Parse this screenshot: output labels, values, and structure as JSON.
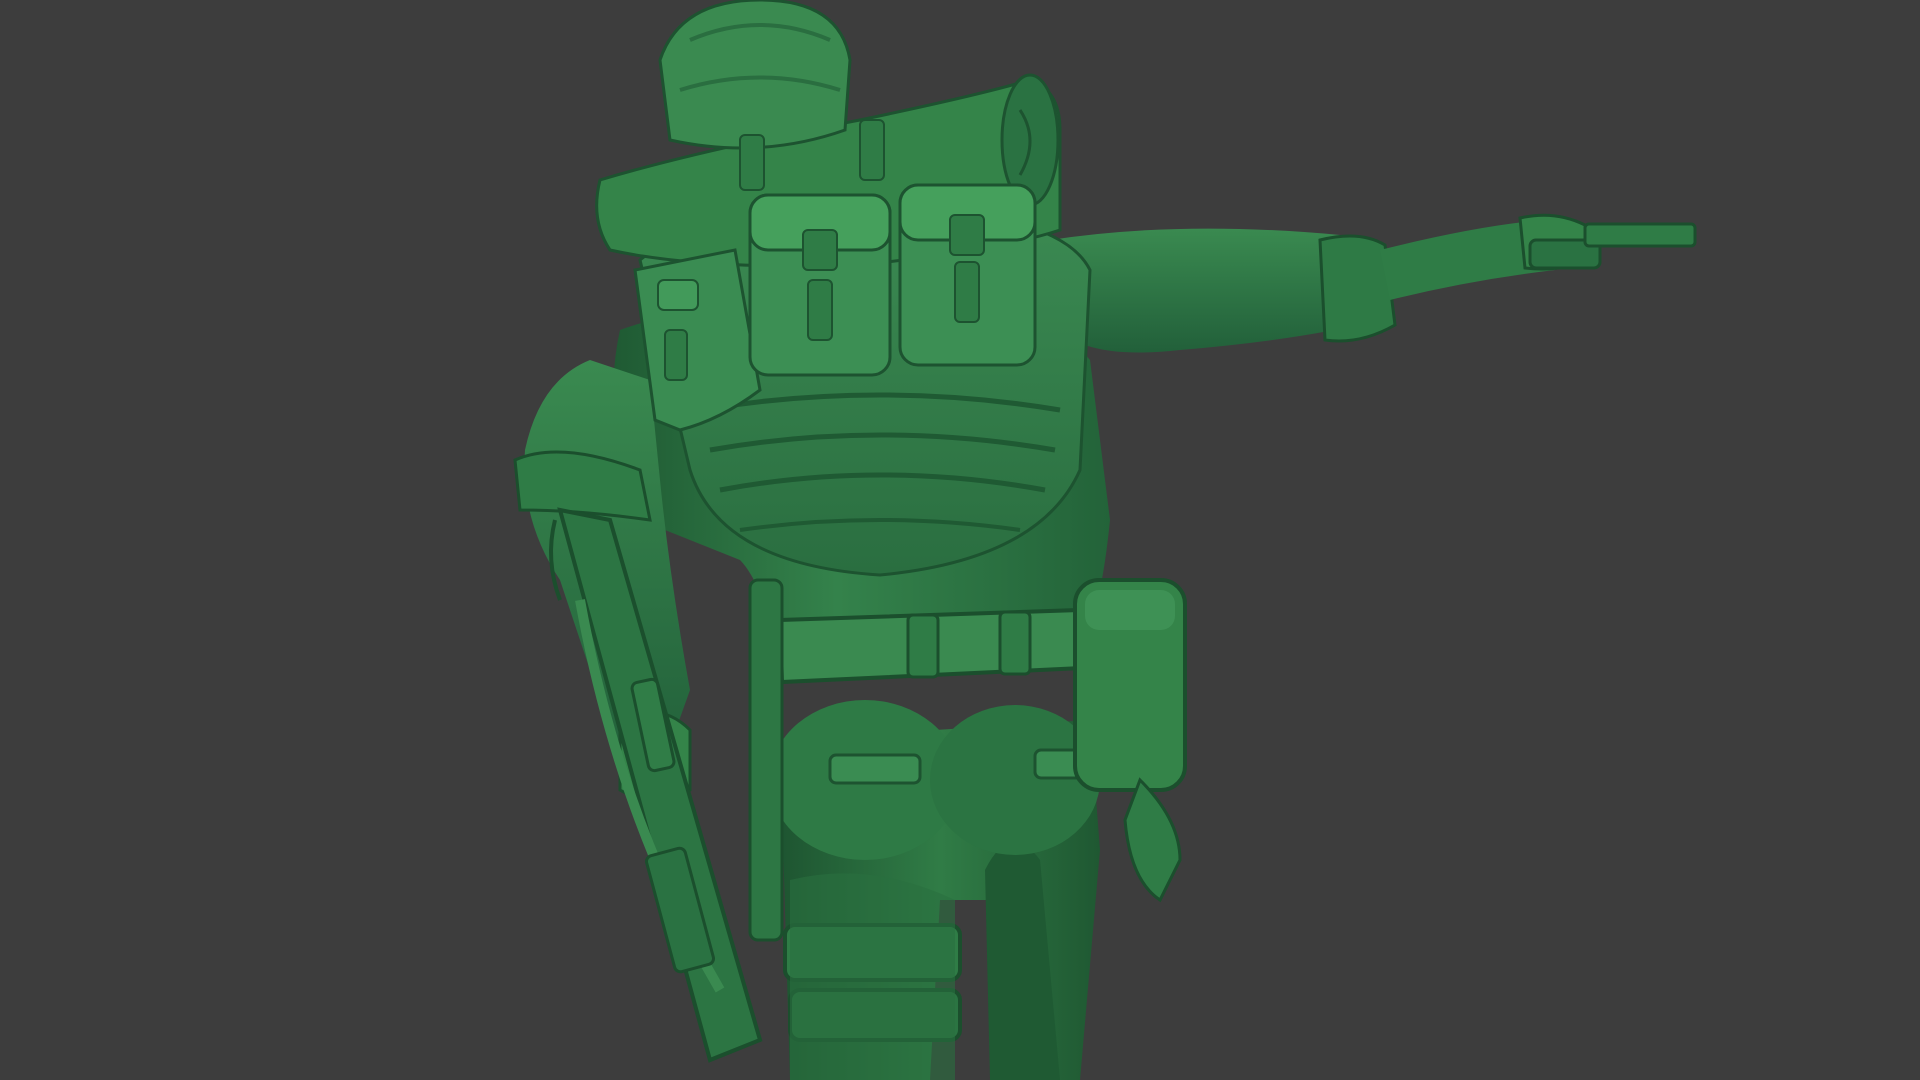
{
  "viewport": {
    "background": "#3d3d3d",
    "model_color": "#2f7a45",
    "model_shadow": "#1e5530",
    "model_highlight": "#4a9a5e"
  },
  "model": {
    "subject": "soldier-figurine-back-view",
    "parts": [
      "helmet",
      "backpack",
      "bedroll",
      "ammo-pouches",
      "right-arm",
      "pistol",
      "left-arm",
      "rifle",
      "belt",
      "hip-pouch",
      "thigh-holster",
      "legs"
    ]
  }
}
